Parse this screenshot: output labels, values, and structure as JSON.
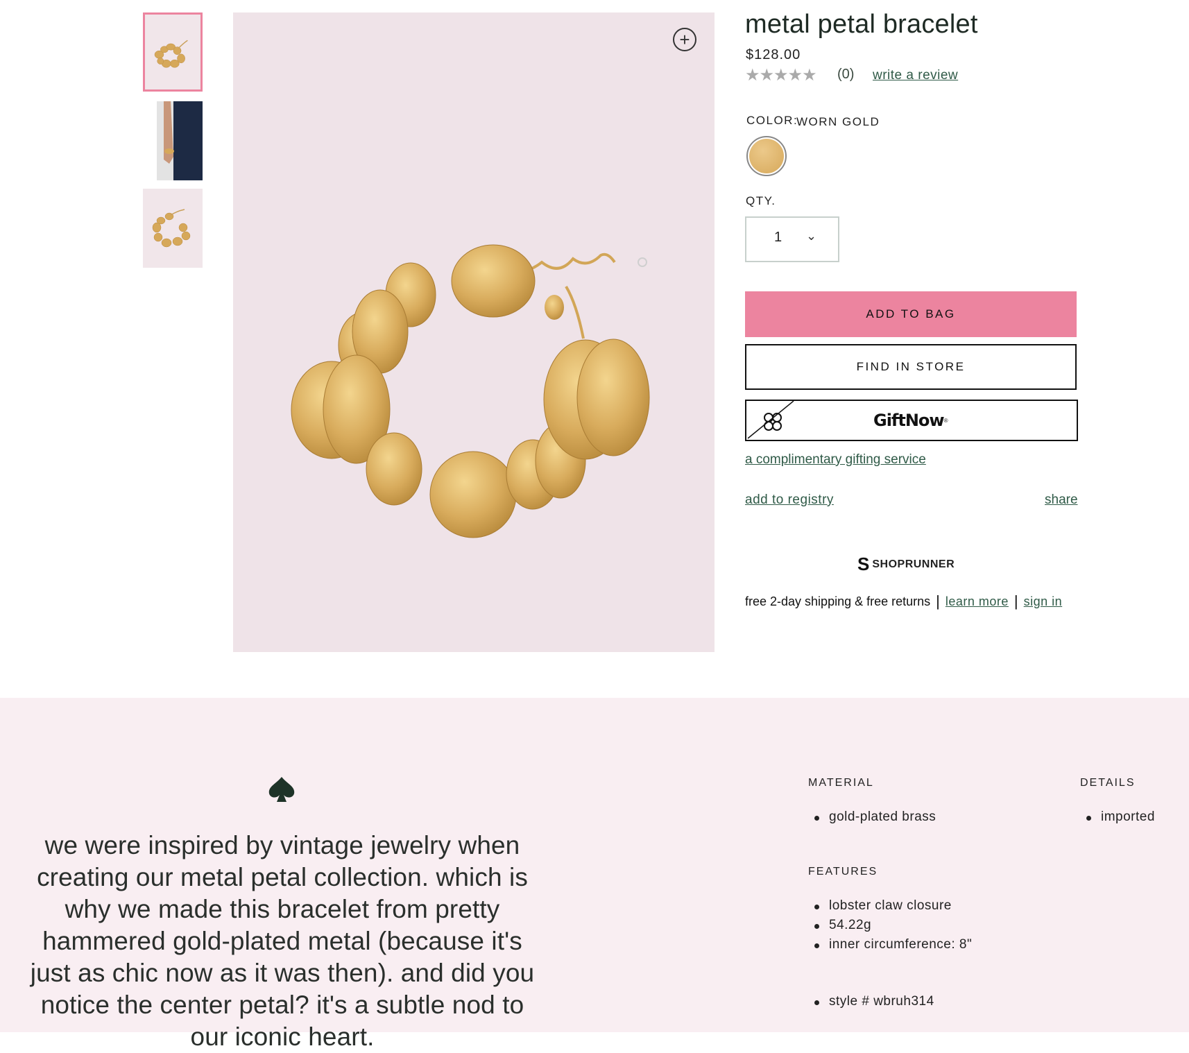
{
  "product": {
    "title": "metal petal bracelet",
    "price": "$128.00",
    "rating_stars": "★★★★★",
    "rating_value": 0,
    "review_count": "(0)",
    "write_review": "write a review",
    "color_label": "COLOR:",
    "color_value": "WORN GOLD",
    "swatch_color": "#dcb26a",
    "qty_label": "QTY.",
    "qty_value": "1",
    "zoom_icon": "+"
  },
  "actions": {
    "add_to_bag": "ADD TO BAG",
    "find_in_store": "FIND IN STORE",
    "giftnow": "GiftNow",
    "giftnow_mark": "®",
    "gift_link": "a complimentary gifting service",
    "add_to_registry": "add to registry",
    "share": "share"
  },
  "shoprunner": {
    "brand": "SHOPRUNNER",
    "logo_glyph": "S",
    "shipping_text": "free 2-day shipping & free returns",
    "sep": "|",
    "learn_more": "learn more",
    "sign_in": "sign in"
  },
  "description": {
    "text": "we were inspired by vintage jewelry when creating our metal petal collection. which is why we made this bracelet from pretty hammered gold-plated metal (because it's just as chic now as it was then). and did you notice the center petal? it's a subtle nod to our iconic heart."
  },
  "specs": {
    "material_heading": "MATERIAL",
    "material_items": [
      "gold-plated brass"
    ],
    "details_heading": "DETAILS",
    "details_items": [
      "imported"
    ],
    "features_heading": "FEATURES",
    "features_items": [
      "lobster claw closure",
      "54.22g",
      "inner circumference: 8\""
    ],
    "style_item": "style # wbruh314"
  },
  "colors": {
    "accent_pink": "#ec849f",
    "link_green": "#2f5a47",
    "image_bg": "#efe3e8",
    "band_bg": "#f9eef2",
    "gold": "#d8ab5c"
  }
}
